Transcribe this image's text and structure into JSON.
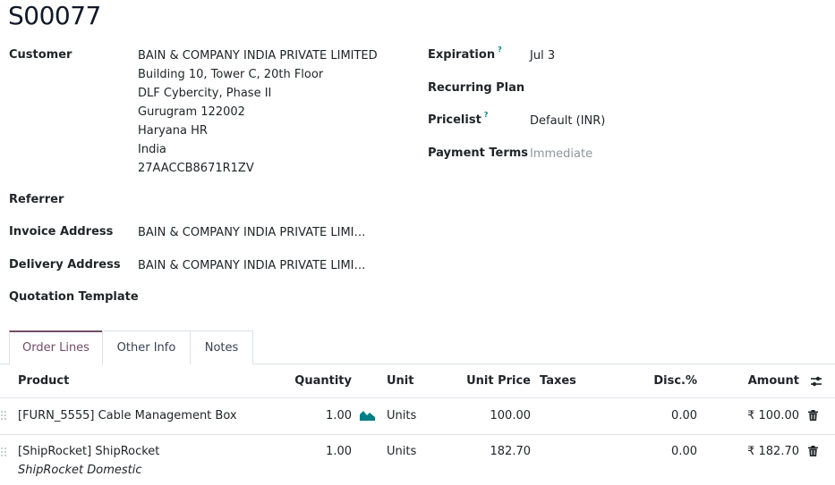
{
  "record": {
    "title": "S00077"
  },
  "form": {
    "customer": {
      "label": "Customer",
      "address_lines": [
        "BAIN & COMPANY INDIA PRIVATE LIMITED",
        "Building 10, Tower C, 20th Floor",
        "DLF Cybercity, Phase II",
        "Gurugram 122002",
        "Haryana HR",
        "India",
        "27AACCB8671R1ZV"
      ]
    },
    "referrer": {
      "label": "Referrer",
      "value": ""
    },
    "invoice_address": {
      "label": "Invoice Address",
      "value": "BAIN & COMPANY INDIA PRIVATE LIMI…"
    },
    "delivery_address": {
      "label": "Delivery Address",
      "value": "BAIN & COMPANY INDIA PRIVATE LIMI…"
    },
    "quotation_template": {
      "label": "Quotation Template",
      "value": ""
    },
    "expiration": {
      "label": "Expiration",
      "help": "?",
      "value": "Jul 3"
    },
    "recurring_plan": {
      "label": "Recurring Plan",
      "value": ""
    },
    "pricelist": {
      "label": "Pricelist",
      "help": "?",
      "value": "Default (INR)"
    },
    "payment_terms": {
      "label": "Payment Terms",
      "placeholder": "Immediate"
    }
  },
  "tabs": [
    {
      "label": "Order Lines",
      "active": true
    },
    {
      "label": "Other Info",
      "active": false
    },
    {
      "label": "Notes",
      "active": false
    }
  ],
  "table": {
    "columns": {
      "product": "Product",
      "quantity": "Quantity",
      "unit": "Unit",
      "unit_price": "Unit Price",
      "taxes": "Taxes",
      "discount": "Disc.%",
      "amount": "Amount"
    },
    "rows": [
      {
        "product": "[FURN_5555] Cable Management Box",
        "description": "",
        "quantity": "1.00",
        "unit": "Units",
        "unit_price": "100.00",
        "taxes": "",
        "discount": "0.00",
        "amount": "₹ 100.00"
      },
      {
        "product": "[ShipRocket] ShipRocket",
        "description": "ShipRocket Domestic",
        "quantity": "1.00",
        "unit": "Units",
        "unit_price": "182.70",
        "taxes": "",
        "discount": "0.00",
        "amount": "₹ 182.70"
      }
    ]
  },
  "colors": {
    "accent": "#714b67",
    "teal": "#017e84",
    "border": "#dee2e6",
    "muted": "#8f959b"
  }
}
